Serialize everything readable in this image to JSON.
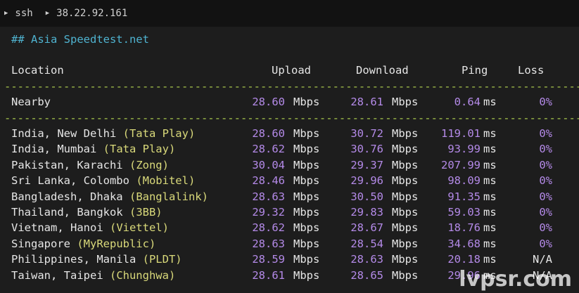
{
  "window": {
    "title_parts": [
      "ssh",
      "38.22.92.161"
    ]
  },
  "section_header": "## Asia Speedtest.net",
  "columns": {
    "location": "Location",
    "upload": "Upload",
    "download": "Download",
    "ping": "Ping",
    "loss": "Loss"
  },
  "separator": "-------------------------------------------------------------------------------------------",
  "units": {
    "speed": "Mbps",
    "latency": "ms"
  },
  "nearby": {
    "location": "Nearby",
    "upload": "28.60",
    "download": "28.61",
    "ping": "0.64",
    "loss": "0%"
  },
  "rows": [
    {
      "place": "India, New Delhi ",
      "isp": "(Tata Play)",
      "upload": "28.60",
      "download": "30.72",
      "ping": "119.01",
      "loss": "0%"
    },
    {
      "place": "India, Mumbai ",
      "isp": "(Tata Play)",
      "upload": "28.62",
      "download": "30.76",
      "ping": "93.99",
      "loss": "0%"
    },
    {
      "place": "Pakistan, Karachi ",
      "isp": "(Zong)",
      "upload": "30.04",
      "download": "29.37",
      "ping": "207.99",
      "loss": "0%"
    },
    {
      "place": "Sri Lanka, Colombo ",
      "isp": "(Mobitel)",
      "upload": "28.46",
      "download": "29.96",
      "ping": "98.09",
      "loss": "0%"
    },
    {
      "place": "Bangladesh, Dhaka ",
      "isp": "(Banglalink)",
      "upload": "28.63",
      "download": "30.50",
      "ping": "91.35",
      "loss": "0%"
    },
    {
      "place": "Thailand, Bangkok ",
      "isp": "(3BB)",
      "upload": "29.32",
      "download": "29.83",
      "ping": "59.03",
      "loss": "0%"
    },
    {
      "place": "Vietnam, Hanoi ",
      "isp": "(Viettel)",
      "upload": "28.62",
      "download": "28.67",
      "ping": "18.76",
      "loss": "0%"
    },
    {
      "place": "Singapore ",
      "isp": "(MyRepublic)",
      "upload": "28.63",
      "download": "28.54",
      "ping": "34.68",
      "loss": "0%"
    },
    {
      "place": "Philippines, Manila ",
      "isp": "(PLDT)",
      "upload": "28.59",
      "download": "28.63",
      "ping": "20.18",
      "loss": "N/A"
    },
    {
      "place": "Taiwan, Taipei ",
      "isp": "(Chunghwa)",
      "upload": "28.61",
      "download": "28.65",
      "ping": "29.96",
      "loss": "N/A"
    }
  ],
  "watermark": "lvpsr.com",
  "colors": {
    "number": "#b48ae8",
    "isp": "#d9d97a",
    "header": "#4fb3d0",
    "separator": "#a9c84d"
  }
}
